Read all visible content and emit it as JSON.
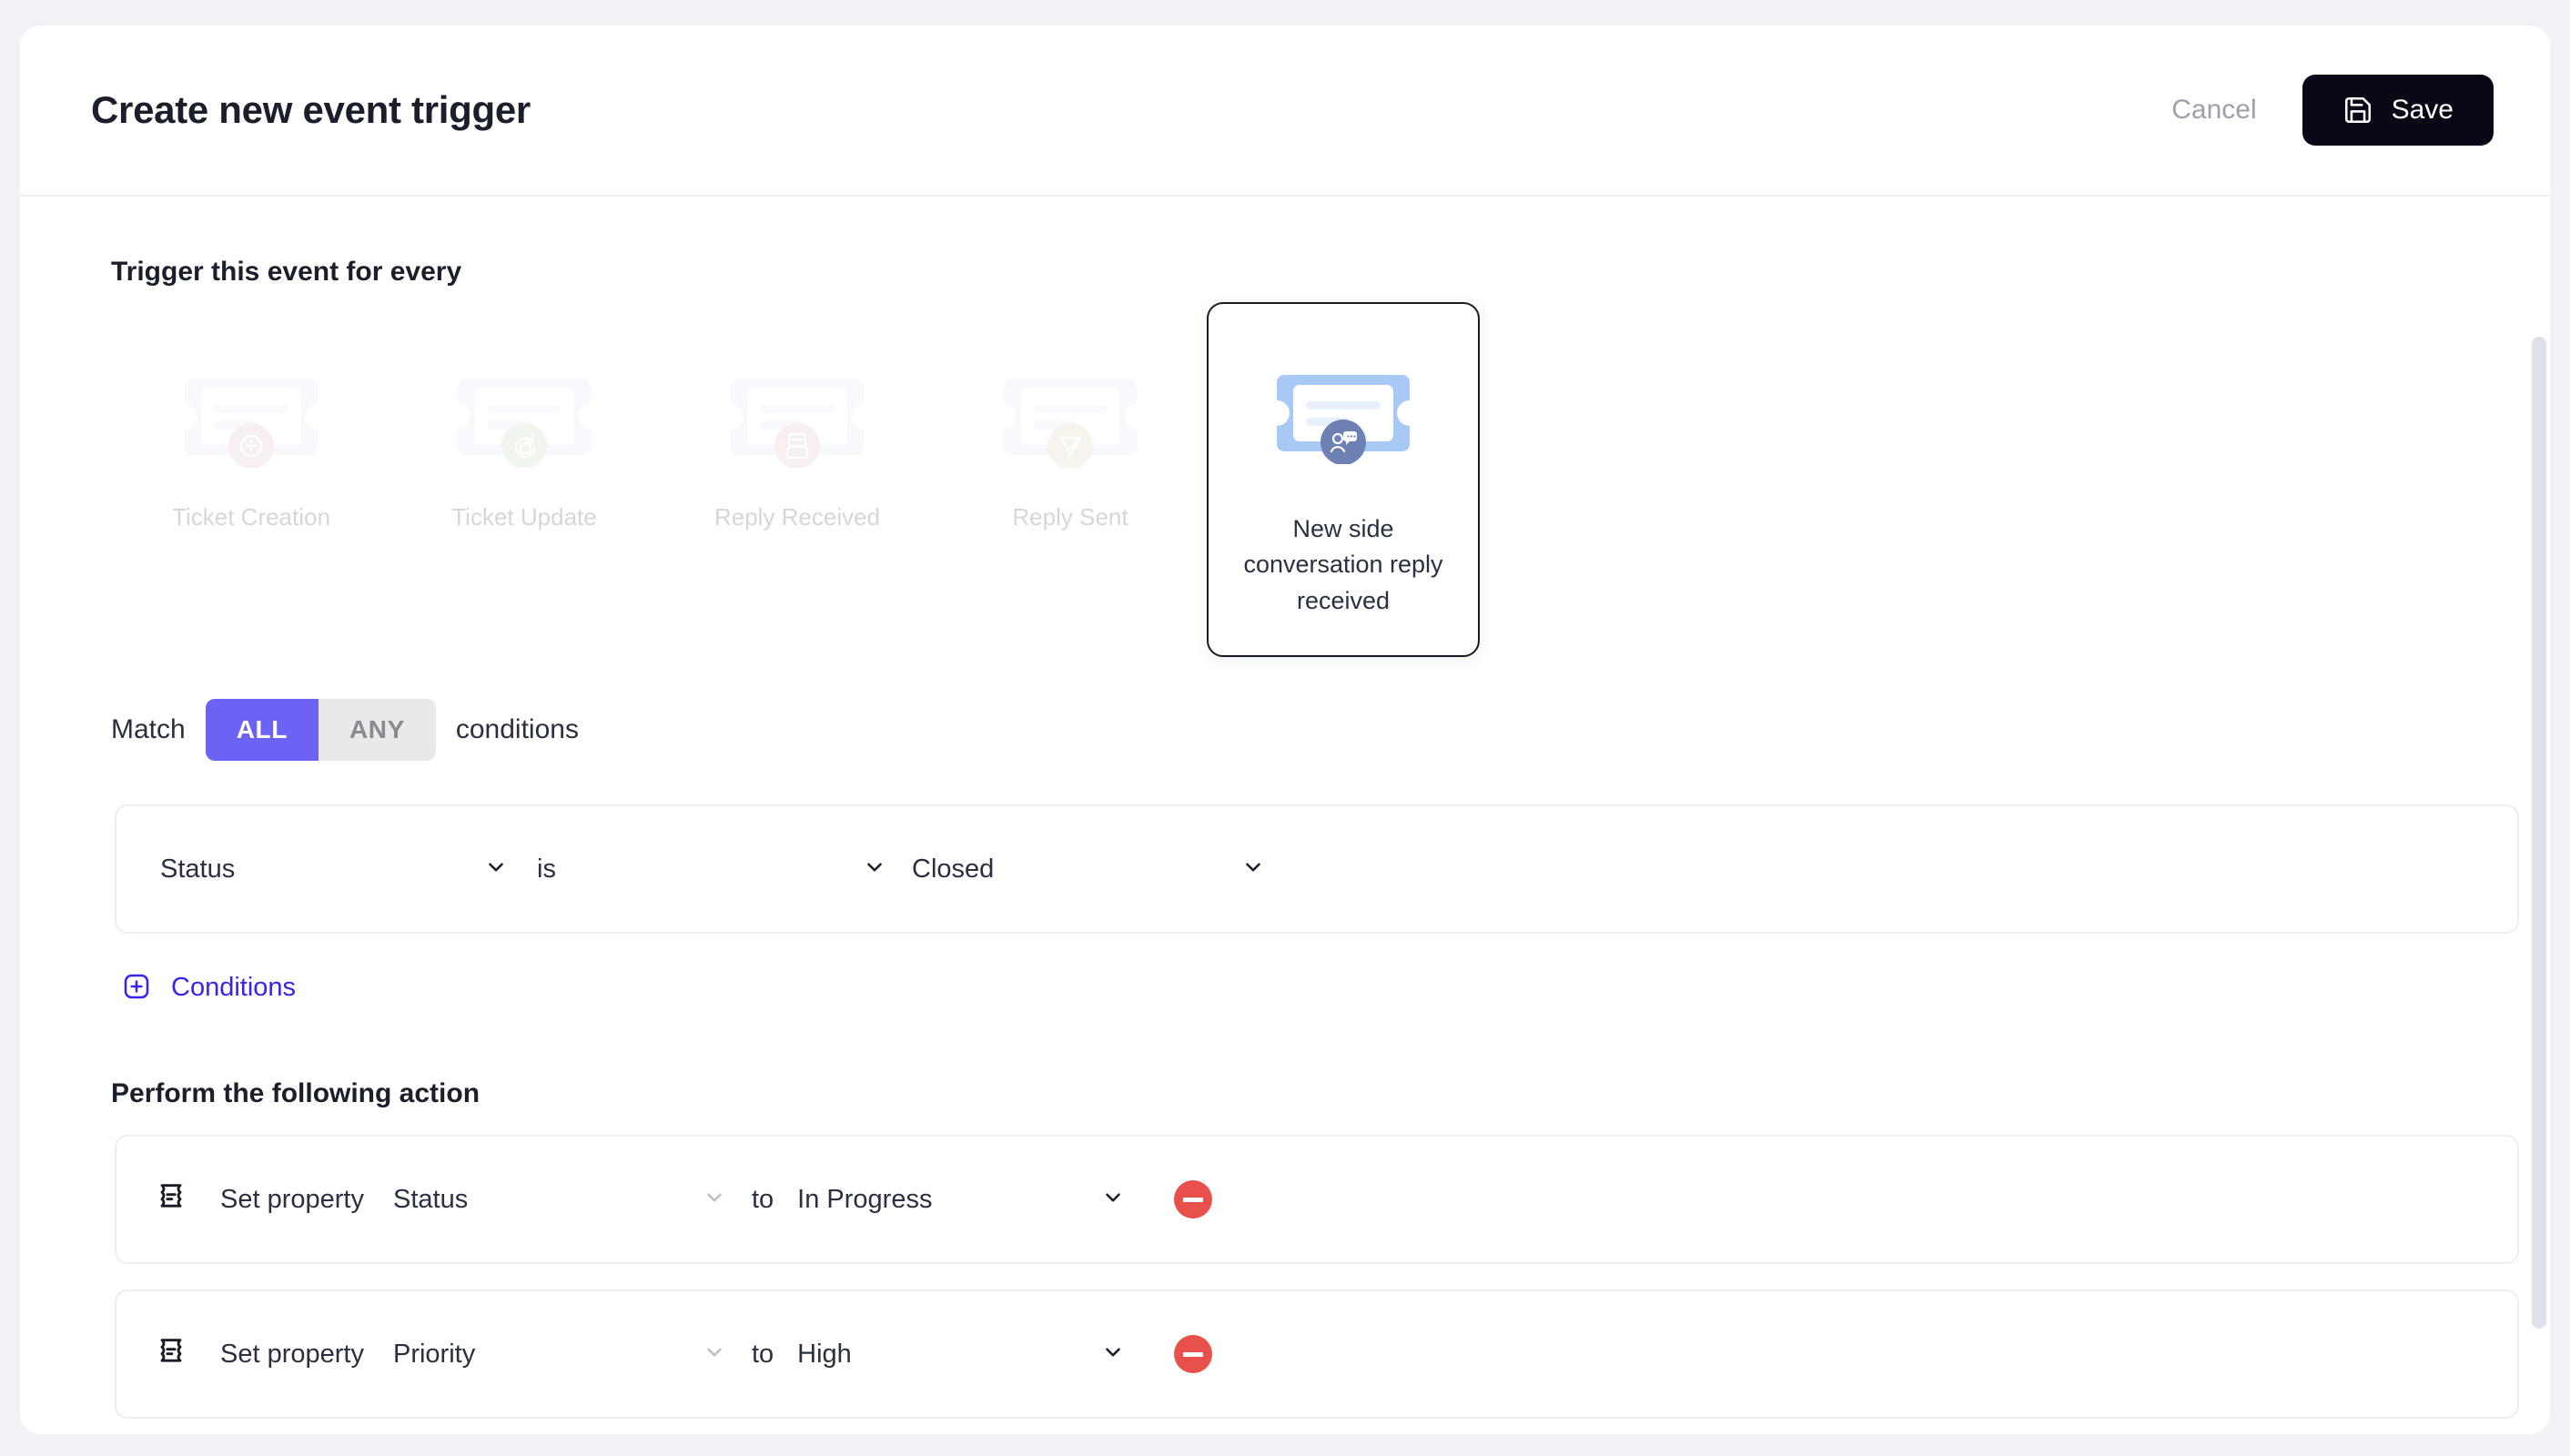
{
  "header": {
    "title": "Create new event trigger",
    "cancel_label": "Cancel",
    "save_label": "Save",
    "save_icon": "floppy-disk-icon"
  },
  "trigger_section": {
    "label": "Trigger this event for every",
    "cards": [
      {
        "label": "Ticket Creation",
        "badge_icon": "plus-circle-icon",
        "badge_color": "#f0dbe2",
        "selected": false
      },
      {
        "label": "Ticket Update",
        "badge_icon": "refresh-ticket-icon",
        "badge_color": "#dcecd9",
        "selected": false
      },
      {
        "label": "Reply Received",
        "badge_icon": "inbox-reply-icon",
        "badge_color": "#eddbdd",
        "selected": false
      },
      {
        "label": "Reply Sent",
        "badge_icon": "send-plane-icon",
        "badge_color": "#ece7d5",
        "selected": false
      },
      {
        "label": "New side conversation reply received",
        "badge_icon": "person-chat-icon",
        "badge_color": "#6d81b5",
        "selected": true
      }
    ]
  },
  "match": {
    "prefix": "Match",
    "suffix": "conditions",
    "options": [
      "ALL",
      "ANY"
    ],
    "selected": "ALL",
    "active_color": "#6c63f5"
  },
  "conditions": [
    {
      "property": "Status",
      "operator": "is",
      "value": "Closed"
    }
  ],
  "add_conditions": {
    "label": "Conditions",
    "icon": "plus-square-icon",
    "color": "#3a23e8"
  },
  "actions_section": {
    "heading": "Perform the following action",
    "rows": [
      {
        "icon": "ticket-outline-icon",
        "verb": "Set property",
        "property": "Status",
        "connector": "to",
        "value": "In Progress",
        "remove_icon": "minus-circle-icon"
      },
      {
        "icon": "ticket-outline-icon",
        "verb": "Set property",
        "property": "Priority",
        "connector": "to",
        "value": "High",
        "remove_icon": "minus-circle-icon"
      }
    ]
  },
  "colors": {
    "page_background": "#f1f2f6",
    "surface": "#ffffff",
    "accent_purple": "#6c63f5",
    "accent_indigo": "#3a23e8",
    "danger_red": "#e8514b",
    "save_dark": "#0b0717",
    "muted_text": "#9aa0ad"
  }
}
